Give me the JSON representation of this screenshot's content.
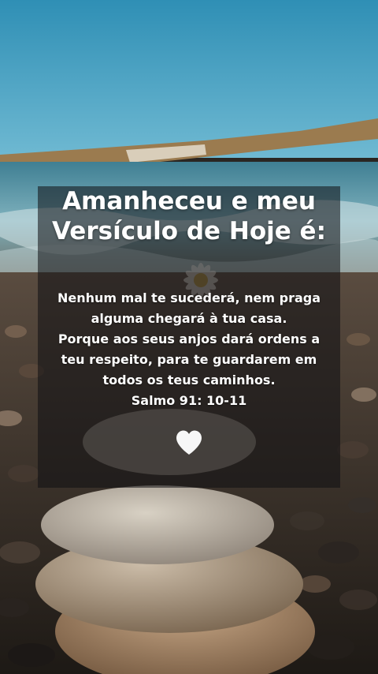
{
  "post": {
    "headline": [
      "Amanheceu e meu",
      "Versículo de Hoje é:"
    ],
    "verse_lines": [
      "Nenhum mal te sucederá, nem praga",
      "alguma chegará à tua casa.",
      "Porque aos seus anjos dará ordens a",
      "teu respeito, para te guardarem em",
      "todos os teus caminhos.",
      "Salmo 91: 10-11"
    ],
    "heart_icon": "white-heart-icon"
  },
  "colors": {
    "sky": "#3e9fc2",
    "sea": "#4e8ea1",
    "overlay": "#0f0f12",
    "text": "#ffffff"
  }
}
